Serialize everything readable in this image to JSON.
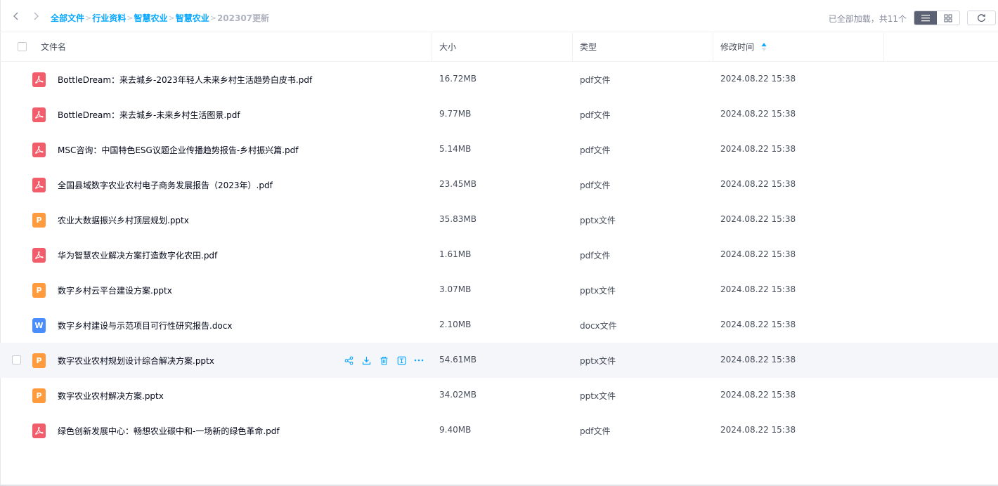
{
  "breadcrumb": {
    "items": [
      "全部文件",
      "行业资料",
      "智慧农业",
      "智慧农业"
    ],
    "separator": ">",
    "current": "202307更新"
  },
  "status": {
    "loaded_text": "已全部加载，共11个"
  },
  "view": {
    "mode": "list"
  },
  "columns": {
    "name": "文件名",
    "size": "大小",
    "type": "类型",
    "modified": "修改时间"
  },
  "sort": {
    "column": "modified",
    "direction": "ascending"
  },
  "files": [
    {
      "icon": "pdf-icon",
      "icon_letter": "",
      "name": "BottleDream：来去城乡-2023年轻人未来乡村生活趋势白皮书.pdf",
      "size": "16.72MB",
      "type": "pdf文件",
      "modified": "2024.08.22 15:38"
    },
    {
      "icon": "pdf-icon",
      "icon_letter": "",
      "name": "BottleDream：来去城乡-未来乡村生活图景.pdf",
      "size": "9.77MB",
      "type": "pdf文件",
      "modified": "2024.08.22 15:38"
    },
    {
      "icon": "pdf-icon",
      "icon_letter": "",
      "name": "MSC咨询：中国特色ESG议题企业传播趋势报告-乡村振兴篇.pdf",
      "size": "5.14MB",
      "type": "pdf文件",
      "modified": "2024.08.22 15:38"
    },
    {
      "icon": "pdf-icon",
      "icon_letter": "",
      "name": "全国县域数字农业农村电子商务发展报告（2023年）.pdf",
      "size": "23.45MB",
      "type": "pdf文件",
      "modified": "2024.08.22 15:38"
    },
    {
      "icon": "pptx-icon",
      "icon_letter": "P",
      "name": "农业大数据振兴乡村顶层规划.pptx",
      "size": "35.83MB",
      "type": "pptx文件",
      "modified": "2024.08.22 15:38"
    },
    {
      "icon": "pdf-icon",
      "icon_letter": "",
      "name": "华为智慧农业解决方案打造数字化农田.pdf",
      "size": "1.61MB",
      "type": "pdf文件",
      "modified": "2024.08.22 15:38"
    },
    {
      "icon": "pptx-icon",
      "icon_letter": "P",
      "name": "数字乡村云平台建设方案.pptx",
      "size": "3.07MB",
      "type": "pptx文件",
      "modified": "2024.08.22 15:38"
    },
    {
      "icon": "docx-icon",
      "icon_letter": "W",
      "name": "数字乡村建设与示范项目可行性研究报告.docx",
      "size": "2.10MB",
      "type": "docx文件",
      "modified": "2024.08.22 15:38"
    },
    {
      "icon": "pptx-icon",
      "icon_letter": "P",
      "name": "数字农业农村规划设计综合解决方案.pptx",
      "size": "54.61MB",
      "type": "pptx文件",
      "modified": "2024.08.22 15:38",
      "hovered": true
    },
    {
      "icon": "pptx-icon",
      "icon_letter": "P",
      "name": "数字农业农村解决方案.pptx",
      "size": "34.02MB",
      "type": "pptx文件",
      "modified": "2024.08.22 15:38"
    },
    {
      "icon": "pdf-icon",
      "icon_letter": "",
      "name": "绿色创新发展中心：畅想农业碳中和-一场新的绿色革命.pdf",
      "size": "9.40MB",
      "type": "pdf文件",
      "modified": "2024.08.22 15:38"
    }
  ],
  "row_actions": [
    "share-icon",
    "download-icon",
    "delete-icon",
    "rename-icon",
    "more-icon"
  ],
  "colors": {
    "accent": "#06a7ff",
    "pdf": "#f25d6b",
    "pptx": "#ff9b3d",
    "docx": "#4a8dff",
    "hover_row": "#f5f6fa"
  }
}
